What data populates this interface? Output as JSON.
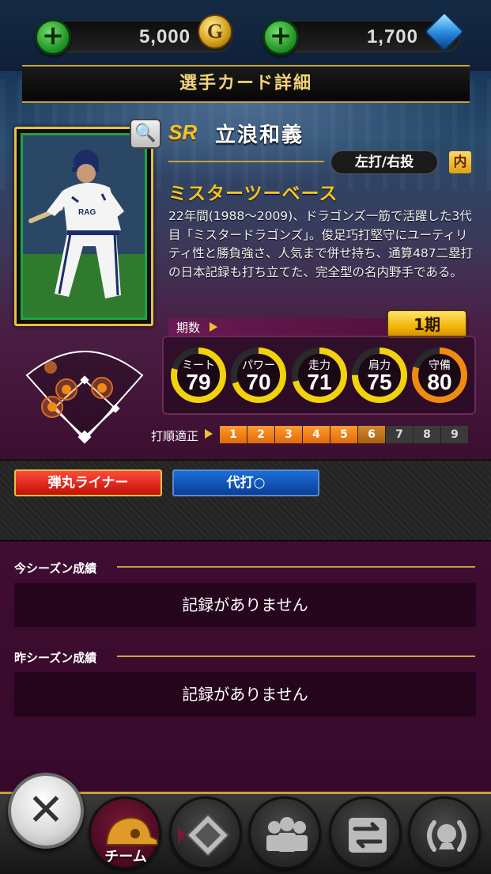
{
  "currency": {
    "gold": "5,000",
    "gold_icon": "G",
    "gems": "1,700"
  },
  "title": "選手カード詳細",
  "player": {
    "rarity": "SR",
    "name": "立浪和義",
    "bat_throw": "左打/右投",
    "position": "内",
    "catchphrase": "ミスターツーベース",
    "description": "22年間(1988〜2009)、ドラゴンズ一筋で活躍した3代目「ミスタードラゴンズ」。俊足巧打堅守にユーティリティ性と勝負強さ、人気まで併せ持ち、通算487二塁打の日本記録も打ち立てた、完全型の名内野手である。"
  },
  "period": {
    "label": "期数",
    "value": "1期"
  },
  "stats": [
    {
      "label": "ミート",
      "value": "79",
      "fraction": 0.79,
      "color": "#f2d20c"
    },
    {
      "label": "パワー",
      "value": "70",
      "fraction": 0.7,
      "color": "#f2d20c"
    },
    {
      "label": "走力",
      "value": "71",
      "fraction": 0.71,
      "color": "#f2d20c"
    },
    {
      "label": "肩力",
      "value": "75",
      "fraction": 0.75,
      "color": "#f2d20c"
    },
    {
      "label": "守備",
      "value": "80",
      "fraction": 0.8,
      "color": "#f08a12"
    }
  ],
  "batting_order": {
    "label": "打順適正",
    "slots": [
      {
        "n": "1",
        "state": "on"
      },
      {
        "n": "2",
        "state": "on"
      },
      {
        "n": "3",
        "state": "on"
      },
      {
        "n": "4",
        "state": "on"
      },
      {
        "n": "5",
        "state": "on"
      },
      {
        "n": "6",
        "state": "mid"
      },
      {
        "n": "7",
        "state": "off"
      },
      {
        "n": "8",
        "state": "off"
      },
      {
        "n": "9",
        "state": "off"
      }
    ]
  },
  "skills": {
    "skill1": "弾丸ライナー",
    "skill2": "代打○"
  },
  "records": {
    "this_season_label": "今シーズン成績",
    "this_season_value": "記録がありません",
    "last_season_label": "昨シーズン成績",
    "last_season_value": "記録がありません"
  },
  "nav": {
    "team_label": "チーム"
  }
}
